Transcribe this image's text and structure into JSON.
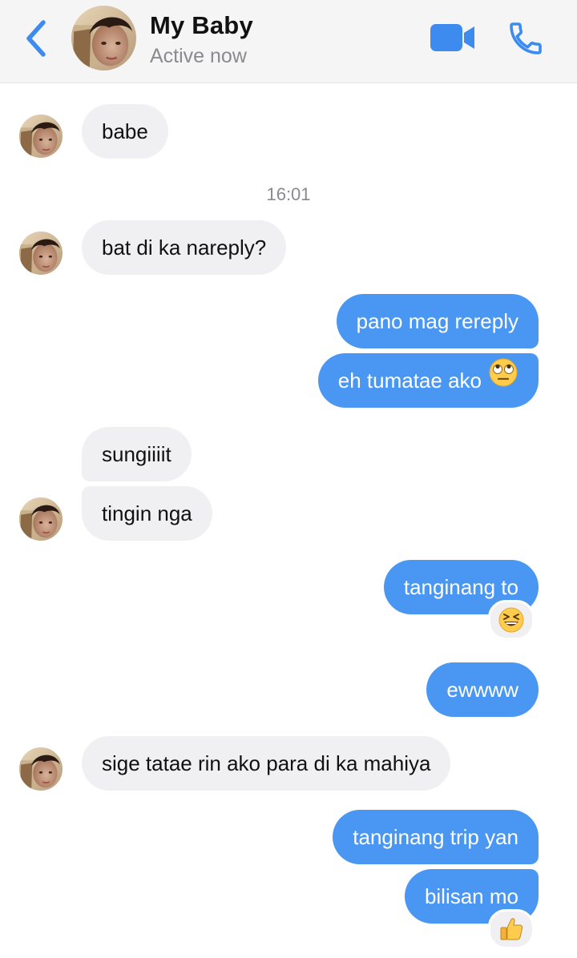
{
  "header": {
    "contact_name": "My Baby",
    "status": "Active now",
    "back_icon": "chevron-left-icon",
    "video_icon": "video-camera-icon",
    "call_icon": "phone-icon"
  },
  "colors": {
    "accent": "#4a97f3",
    "incoming_bubble": "#f0f0f3",
    "header_bg": "#f5f5f6"
  },
  "timestamp": "16:01",
  "messages": [
    {
      "from": "contact",
      "text": "babe"
    },
    {
      "from": "contact",
      "text": "bat di ka nareply?"
    },
    {
      "from": "me",
      "text": "pano mag rereply"
    },
    {
      "from": "me",
      "text": "eh tumatae ako",
      "emoji": "face-with-rolling-eyes"
    },
    {
      "from": "contact",
      "text": "sungiiiit"
    },
    {
      "from": "contact",
      "text": "tingin nga"
    },
    {
      "from": "me",
      "text": "tanginang to",
      "reaction": "grinning-squinting-face"
    },
    {
      "from": "me",
      "text": "ewwww"
    },
    {
      "from": "contact",
      "text": "sige tatae rin ako para di ka mahiya"
    },
    {
      "from": "me",
      "text": "tanginang trip yan"
    },
    {
      "from": "me",
      "text": "bilisan mo",
      "reaction": "thumbs-up"
    }
  ]
}
